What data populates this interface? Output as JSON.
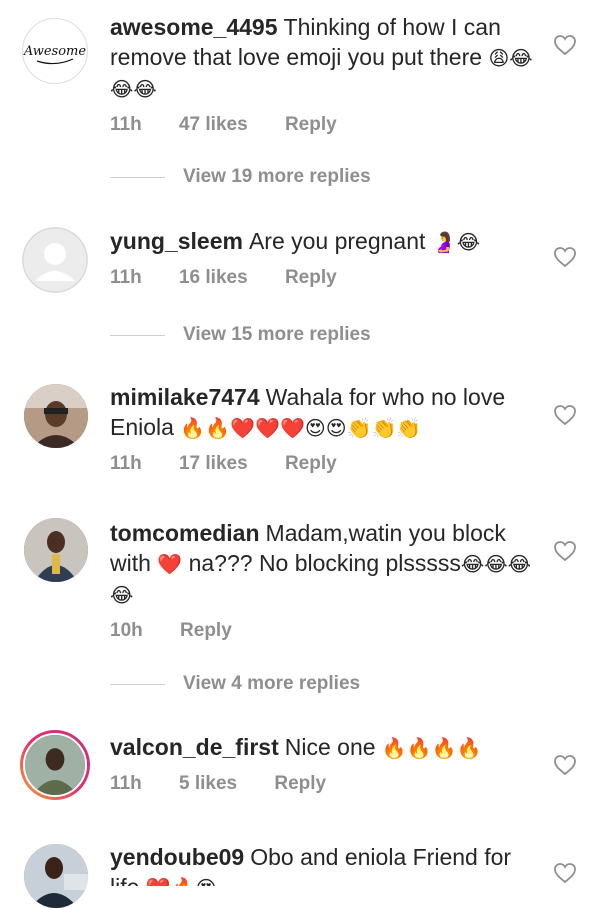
{
  "comments": [
    {
      "username": "awesome_4495",
      "text": "Thinking of how I can remove that love emoji you put there",
      "emoji": "😩😂😂😂",
      "time": "11h",
      "likes": "47 likes",
      "reply": "Reply",
      "avatar_text": "Awesome",
      "view_replies": "View 19 more replies"
    },
    {
      "username": "yung_sleem",
      "text": "Are you pregnant",
      "emoji": "🤰😂",
      "time": "11h",
      "likes": "16 likes",
      "reply": "Reply",
      "view_replies": "View 15 more replies"
    },
    {
      "username": "mimilake7474",
      "text": "Wahala for who no love Eniola",
      "emoji": "🔥🔥❤️❤️❤️😍😍👏👏👏",
      "time": "11h",
      "likes": "17 likes",
      "reply": "Reply"
    },
    {
      "username": "tomcomedian",
      "text": "Madam,watin you block with",
      "emoji": "❤️",
      "text2": "na??? No blocking plsssss",
      "emoji2": "😂😂😂😂",
      "time": "10h",
      "reply": "Reply",
      "view_replies": "View 4 more replies"
    },
    {
      "username": "valcon_de_first",
      "text": "Nice one",
      "emoji": "🔥🔥🔥🔥",
      "time": "11h",
      "likes": "5 likes",
      "reply": "Reply"
    },
    {
      "username": "yendoube09",
      "text": "Obo and eniola Friend for life",
      "emoji": "❤️🔥😍"
    }
  ],
  "colors": {
    "text": "#262626",
    "meta": "#8e8e8e",
    "ring": "#c13584"
  }
}
